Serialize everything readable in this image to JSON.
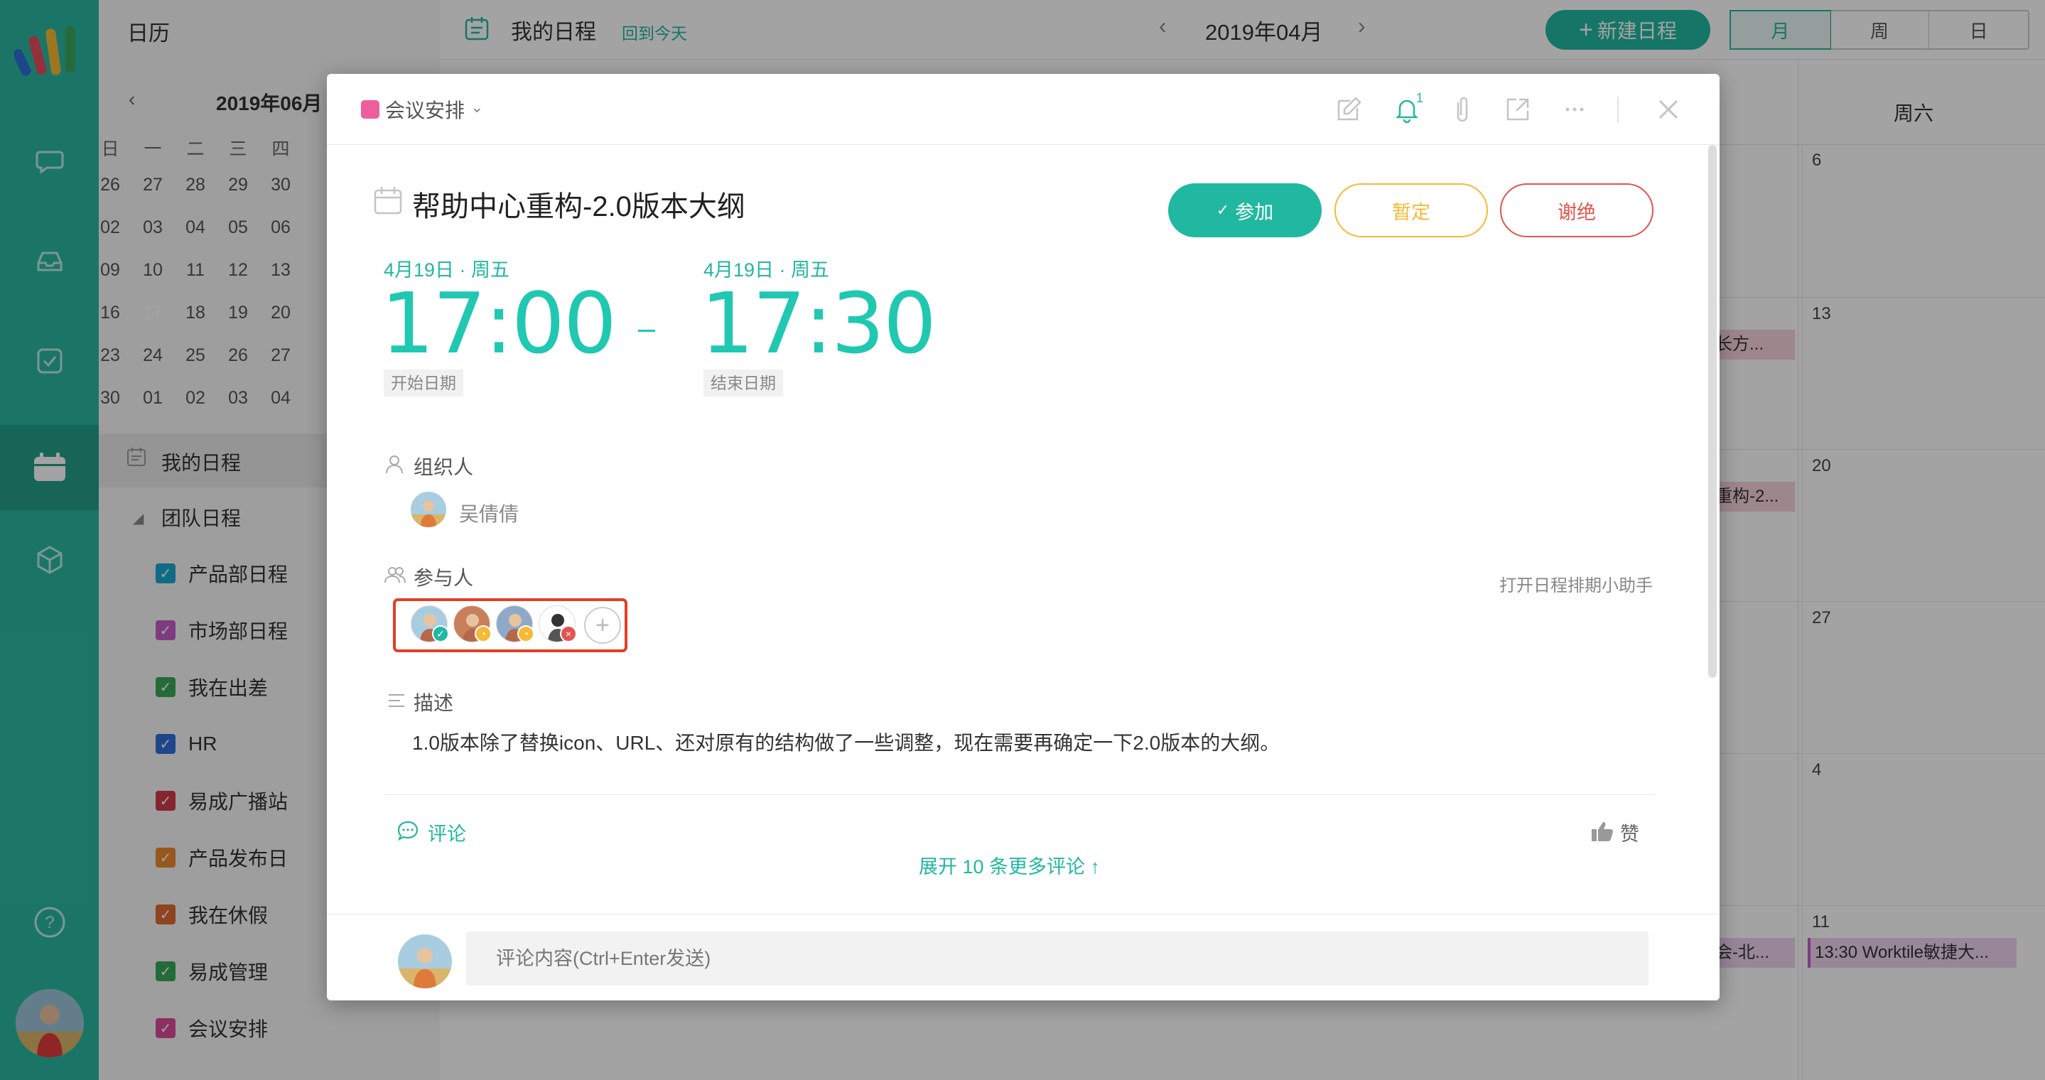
{
  "colors": {
    "brand": "#21b8a1",
    "danger": "#e35450",
    "warning": "#f6b936",
    "highlight": "#e04027"
  },
  "sidebar": {
    "title": "日历",
    "mini": {
      "title": "2019年06月",
      "weekdays": [
        "日",
        "一",
        "二",
        "三",
        "四"
      ],
      "days": [
        [
          "26",
          "27",
          "28",
          "29",
          "30"
        ],
        [
          "02",
          "03",
          "04",
          "05",
          "06"
        ],
        [
          "09",
          "10",
          "11",
          "12",
          "13"
        ],
        [
          "16",
          "17",
          "18",
          "19",
          "20"
        ],
        [
          "23",
          "24",
          "25",
          "26",
          "27"
        ],
        [
          "30",
          "01",
          "02",
          "03",
          "04"
        ]
      ],
      "selected": "17"
    },
    "my": "我的日程",
    "team": "团队日程",
    "calendars": [
      {
        "label": "产品部日程",
        "color": "#1aaad0"
      },
      {
        "label": "市场部日程",
        "color": "#c25fc7"
      },
      {
        "label": "我在出差",
        "color": "#3aa85a"
      },
      {
        "label": "HR",
        "color": "#2f6ed8"
      },
      {
        "label": "易成广播站",
        "color": "#d23b4a"
      },
      {
        "label": "产品发布日",
        "color": "#ec8a2e"
      },
      {
        "label": "我在休假",
        "color": "#e06a2f"
      },
      {
        "label": "易成管理",
        "color": "#3aa85a"
      },
      {
        "label": "会议安排",
        "color": "#d94c9a"
      }
    ]
  },
  "topbar": {
    "title": "我的日程",
    "today": "回到今天",
    "month": "2019年04月",
    "new_btn": "新建日程",
    "views": [
      "月",
      "周",
      "日"
    ]
  },
  "grid": {
    "sat": "周六",
    "nums": [
      "6",
      "13",
      "20",
      "27",
      "4",
      "11"
    ],
    "events": [
      "…长方...",
      "…重构-2...",
      "…会-北...",
      "13:30 Worktile敏捷大..."
    ]
  },
  "modal": {
    "category": "会议安排",
    "bell_count": "1",
    "title": "帮助中心重构-2.0版本大纲",
    "actions": {
      "join": "参加",
      "tentative": "暂定",
      "decline": "谢绝"
    },
    "start": {
      "date": "4月19日 · 周五",
      "time": "17:00",
      "tag": "开始日期"
    },
    "end": {
      "date": "4月19日 · 周五",
      "time": "17:30",
      "tag": "结束日期"
    },
    "organizer_label": "组织人",
    "organizer": "吴倩倩",
    "participants_label": "参与人",
    "assistant": "打开日程排期小助手",
    "participants": [
      {
        "status": "accepted"
      },
      {
        "status": "tentative"
      },
      {
        "status": "tentative"
      },
      {
        "status": "declined"
      }
    ],
    "desc_label": "描述",
    "desc": "1.0版本除了替换icon、URL、还对原有的结构做了一些调整，现在需要再确定一下2.0版本的大纲。",
    "comment_label": "评论",
    "like_label": "赞",
    "expand": "展开 10 条更多评论 ↑",
    "comment_placeholder": "评论内容(Ctrl+Enter发送)"
  }
}
